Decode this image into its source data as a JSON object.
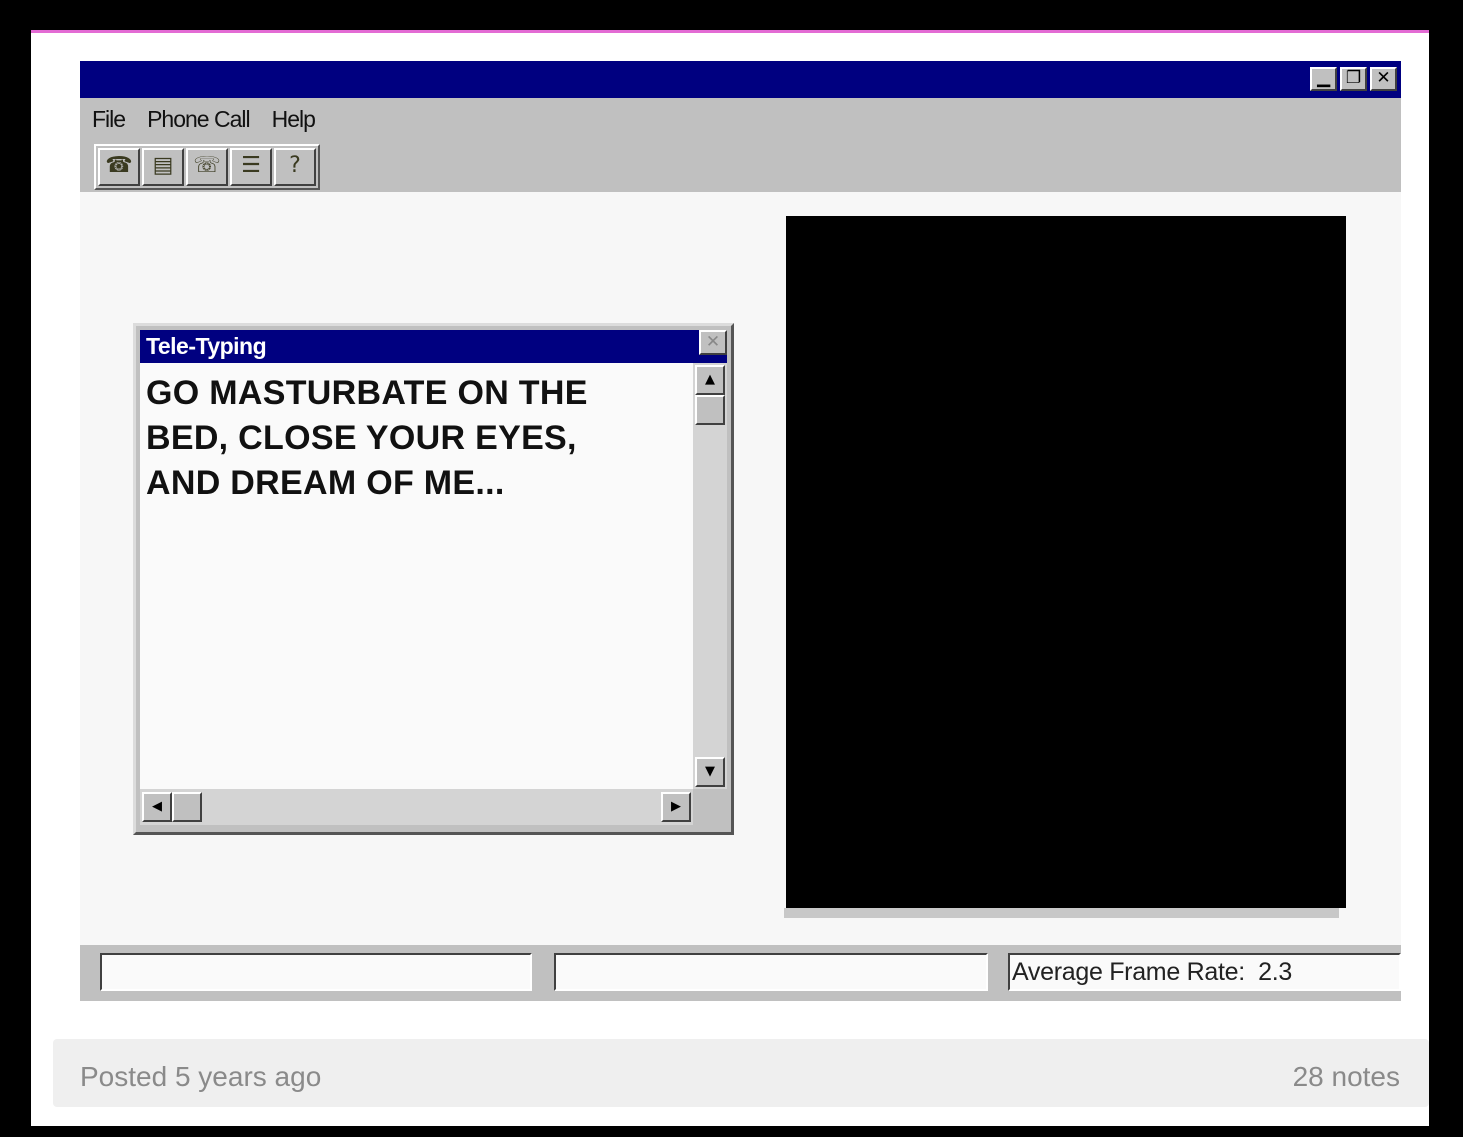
{
  "window": {
    "minimize_glyph": "▁",
    "restore_glyph": "❐",
    "close_glyph": "✕"
  },
  "menu": {
    "items": [
      "File",
      "Phone Call",
      "Help"
    ]
  },
  "toolbar": {
    "buttons": [
      {
        "icon": "dial-phone-icon",
        "glyph": "☎"
      },
      {
        "icon": "phonebook-icon",
        "glyph": "▤"
      },
      {
        "icon": "hang-up-icon",
        "glyph": "☏"
      },
      {
        "icon": "tele-typing-icon",
        "glyph": "☰"
      },
      {
        "icon": "help-icon",
        "glyph": "?"
      }
    ]
  },
  "tele_typing": {
    "title": "Tele-Typing",
    "close_glyph": "✕",
    "message": "GO MASTURBATE ON THE\nBED, CLOSE YOUR EYES,\nAND DREAM OF ME..."
  },
  "status": {
    "panel1": "",
    "panel2": "",
    "panel3": "Average Frame Rate:  2.3"
  },
  "footer": {
    "posted": "Posted 5 years ago",
    "notes": "28 notes"
  },
  "colors": {
    "title_bar": "#000080",
    "chrome_gray": "#c0c0c0",
    "accent_border": "#e36bd4"
  }
}
